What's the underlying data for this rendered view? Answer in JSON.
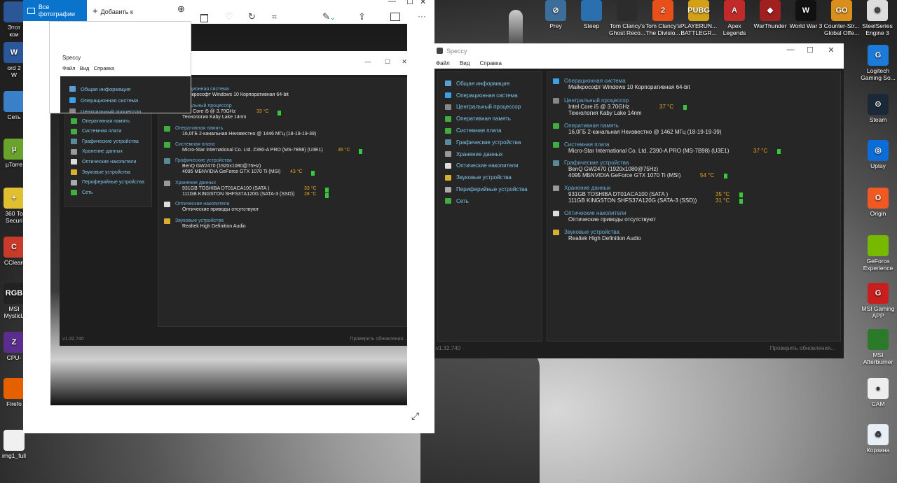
{
  "desktop_icons_left": [
    {
      "label": "Этот\nкои",
      "color": "#2b5797",
      "glyph": ""
    },
    {
      "label": "ord 2\nW",
      "color": "#2b579a",
      "glyph": "W"
    },
    {
      "label": "Сеть",
      "color": "#3a80c8",
      "glyph": ""
    },
    {
      "label": "µTorre",
      "color": "#6aa32c",
      "glyph": "µ"
    },
    {
      "label": "360 To\nSecuri",
      "color": "#e0c030",
      "glyph": "+"
    },
    {
      "label": "CClean",
      "color": "#c83a2a",
      "glyph": "C"
    },
    {
      "label": "MSI\nMysticL",
      "color": "#222",
      "glyph": "RGB"
    },
    {
      "label": "CPU-",
      "color": "#5b2d8e",
      "glyph": "Z"
    },
    {
      "label": "Firefo",
      "color": "#e66000",
      "glyph": ""
    },
    {
      "label": "img1_full",
      "color": "#f0f0f0",
      "glyph": ""
    }
  ],
  "desktop_icons_top": [
    {
      "label": "Prey",
      "color": "#3b6e9a",
      "glyph": "⊘"
    },
    {
      "label": "Steep",
      "color": "#2a6fb0",
      "glyph": ""
    },
    {
      "label": "Tom Clancy's\nGhost Reco...",
      "color": "#2c2c2c",
      "glyph": ""
    },
    {
      "label": "Tom Clancy's\nThe Divisio...",
      "color": "#e8501a",
      "glyph": "2"
    },
    {
      "label": "PLAYERUN...\nBATTLEGR...",
      "color": "#d4a017",
      "glyph": "PUBG"
    },
    {
      "label": "Apex\nLegends",
      "color": "#c02a2a",
      "glyph": "A"
    },
    {
      "label": "WarThunder",
      "color": "#a02020",
      "glyph": "◆"
    },
    {
      "label": "World War 3",
      "color": "#111",
      "glyph": "W"
    },
    {
      "label": "Counter-Str...\nGlobal Offe...",
      "color": "#d98f1c",
      "glyph": "GO"
    },
    {
      "label": "SteelSeries\nEngine 3",
      "color": "#ddd",
      "glyph": "⚙"
    }
  ],
  "desktop_icons_right": [
    {
      "label": "Logitech\nGaming So...",
      "color": "#1c7ad8",
      "glyph": "G"
    },
    {
      "label": "Steam",
      "color": "#1b2838",
      "glyph": "⊙"
    },
    {
      "label": "Uplay",
      "color": "#0d6dd8",
      "glyph": "◎"
    },
    {
      "label": "Origin",
      "color": "#f05a22",
      "glyph": "O"
    },
    {
      "label": "GeForce\nExperience",
      "color": "#76b900",
      "glyph": ""
    },
    {
      "label": "MSI Gaming\nAPP",
      "color": "#c81e1e",
      "glyph": "G"
    },
    {
      "label": "MSI\nAfterburner",
      "color": "#2a7a2a",
      "glyph": ""
    },
    {
      "label": "CAM",
      "color": "#eee",
      "glyph": "●"
    },
    {
      "label": "Корзина",
      "color": "#e8eef5",
      "glyph": "♻"
    }
  ],
  "photos": {
    "tab_label": "Все фотографии",
    "add_label": "Добавить к"
  },
  "speccy": {
    "title": "Speccy",
    "menu": [
      "Файл",
      "Вид",
      "Справка"
    ],
    "nav": [
      {
        "label": "Общая информация",
        "color": "#5aa0d8"
      },
      {
        "label": "Операционная система",
        "color": "#3aa0e8"
      },
      {
        "label": "Центральный процессор",
        "color": "#888"
      },
      {
        "label": "Оперативная память",
        "color": "#3fae3f"
      },
      {
        "label": "Системная плата",
        "color": "#3fae3f"
      },
      {
        "label": "Графические устройства",
        "color": "#5a8a9a"
      },
      {
        "label": "Хранение данных",
        "color": "#999"
      },
      {
        "label": "Оптические накопители",
        "color": "#ddd"
      },
      {
        "label": "Звуковые устройства",
        "color": "#d8b030"
      },
      {
        "label": "Периферийные устройства",
        "color": "#aaa"
      },
      {
        "label": "Сеть",
        "color": "#3fae3f"
      }
    ],
    "os": {
      "head": "Операционная система",
      "value": "Майкрософт Windows 10 Корпоративная 64-bit",
      "value_short": "крософт Windows 10 Корпоративная 64-bit",
      "head_short": "Операц"
    },
    "cpu": {
      "head": "Центральный процессор",
      "line1": "Intel Core i5 @ 3.70GHz",
      "line2": "Технология Kaby Lake 14nm"
    },
    "ram": {
      "head": "Оперативная память",
      "value_right": "16,0ГБ 2-канальная Неизвестно @ 1462 МГц (18-19-19-39)",
      "value_left": "16,0ГБ 2-канальная Неизвестно @ 1446 МГц (18-19-19-39)"
    },
    "mb": {
      "head": "Системная плата",
      "value": "Micro-Star International Co. Ltd. Z390-A PRO (MS-7B98) (U3E1)"
    },
    "gpu": {
      "head": "Графические устройства",
      "line1": "BenQ GW2470 (1920x1080@75Hz)",
      "line2": "4095 МБNVIDIA GeForce GTX 1070 Ti (MSI)"
    },
    "storage": {
      "head": "Хранение данных",
      "line1": "931GB TOSHIBA DT01ACA100 (SATA )",
      "line2": "111GB KINGSTON SHFS37A120G (SATA-3 (SSD))"
    },
    "optical": {
      "head": "Оптические накопители",
      "value": "Оптические приводы отсутствуют"
    },
    "audio": {
      "head": "Звуковые устройства",
      "value": "Realtek High Definition Audio"
    },
    "version": "v1.32.740",
    "update": "Проверить обновления..."
  },
  "temps_right": {
    "cpu": "37 °C",
    "mb": "37 °C",
    "gpu": "54 °C",
    "hdd": "35 °C",
    "ssd": "31 °C"
  },
  "temps_left": {
    "cpu": "33 °C",
    "mb": "36 °C",
    "gpu": "43 °C",
    "hdd": "33 °C",
    "ssd": "28 °C"
  }
}
